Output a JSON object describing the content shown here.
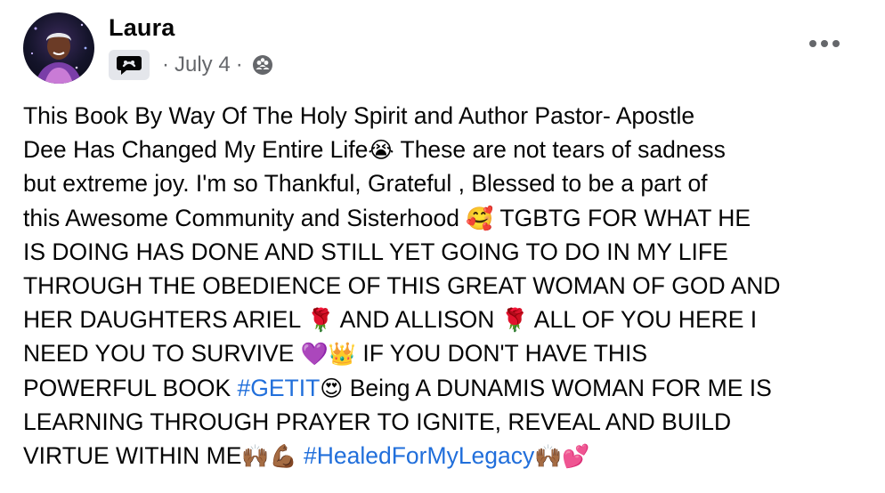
{
  "author": {
    "name": "Laura"
  },
  "meta": {
    "date": "July 4",
    "separator": "·"
  },
  "icons": {
    "group": "group-chat-icon",
    "audience": "audience-icon",
    "more": "more-options-icon"
  },
  "colors": {
    "text": "#050505",
    "secondary": "#65676b",
    "hashtag": "#216fdb",
    "badge_bg": "#e4e6eb"
  },
  "post": {
    "lines": {
      "l1": "This Book  By Way Of The Holy Spirit and  Author Pastor- Apostle",
      "l2a": "Dee  Has Changed  My Entire Life",
      "l2b": " These are not tears of sadness",
      "l3": "but extreme joy. I'm so Thankful, Grateful , Blessed to be a part of",
      "l4a": "this Awesome  Community and Sisterhood ",
      "l4b": " TGBTG FOR WHAT HE",
      "l5": "IS DOING HAS DONE AND STILL YET GOING TO DO IN MY LIFE",
      "l6": "THROUGH THE OBEDIENCE OF THIS GREAT WOMAN OF GOD AND",
      "l7a": "HER DAUGHTERS ARIEL ",
      "l7b": " AND ALLISON ",
      "l7c": " ALL OF YOU HERE I",
      "l8a": "NEED YOU TO SURVIVE ",
      "l8b": " IF YOU DON'T HAVE THIS",
      "l9a": "POWERFUL BOOK ",
      "l9b": " Being A DUNAMIS WOMAN FOR ME IS",
      "l10": "LEARNING THROUGH PRAYER TO IGNITE, REVEAL  AND BUILD",
      "l11a": "VIRTUE WITHIN ME"
    },
    "hashtags": {
      "getit": "#GETIT",
      "healed": "#HealedForMyLegacy"
    },
    "emojis": {
      "crying": "😭",
      "smiling_hearts": "🥰",
      "rose": "🌹",
      "purple_heart": "💜",
      "crown": "👑",
      "heart_eyes": "😍",
      "raising_hands": "🙌🏾",
      "muscle": "💪🏾",
      "two_hearts": "💕"
    }
  }
}
